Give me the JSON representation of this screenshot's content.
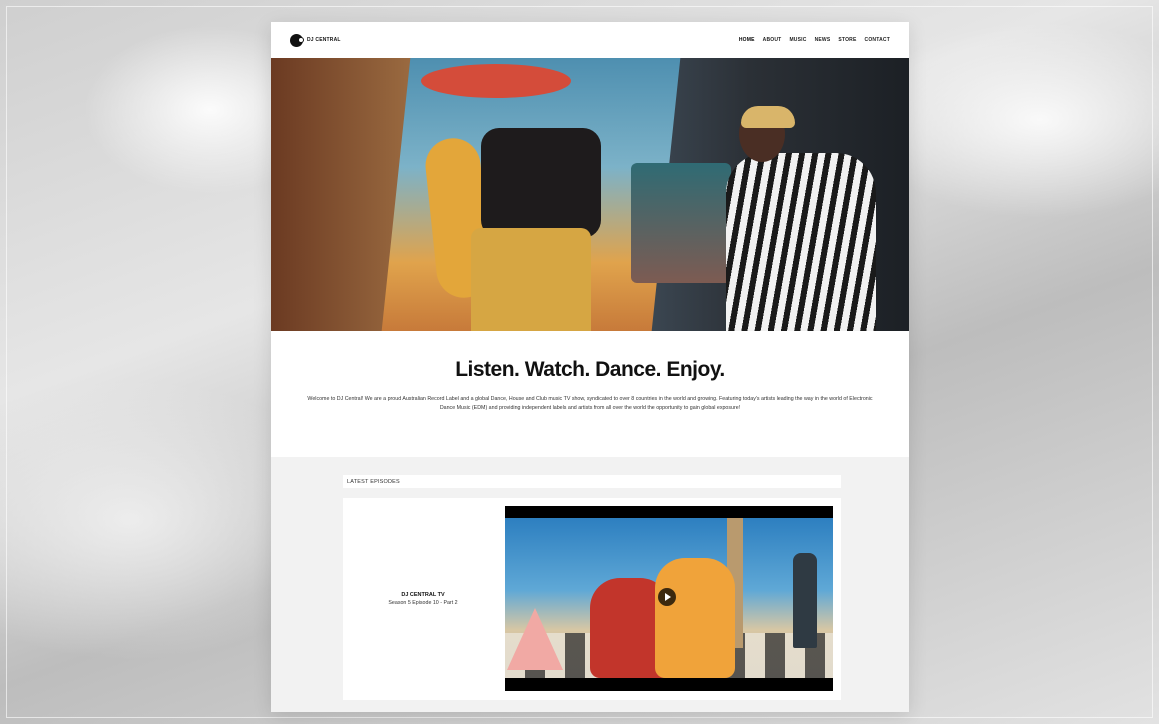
{
  "site": {
    "logo_text": "DJ CENTRAL",
    "nav_items": [
      {
        "label": "HOME",
        "active": true
      },
      {
        "label": "ABOUT",
        "active": false
      },
      {
        "label": "MUSIC",
        "active": false
      },
      {
        "label": "NEWS",
        "active": false
      },
      {
        "label": "STORE",
        "active": false
      },
      {
        "label": "CONTACT",
        "active": false
      }
    ]
  },
  "intro": {
    "headline": "Listen. Watch. Dance. Enjoy.",
    "body": "Welcome to DJ Central! We are a proud Australian Record Label and a global Dance, House and Club music TV show, syndicated to over 8 countries in the world and growing. Featuring today's artists leading the way in the world of Electronic Dance Music (EDM) and providing independent labels and artists from all over the world the opportunity to gain global exposure!"
  },
  "latest_episodes": {
    "header": "LATEST EPISODES",
    "episode": {
      "show": "DJ CENTRAL TV",
      "title": "Season 5 Episode 10 - Part 2"
    }
  },
  "colors": {
    "page_bg": "#ffffff",
    "section_bg": "#f2f2f2",
    "text": "#111111"
  }
}
